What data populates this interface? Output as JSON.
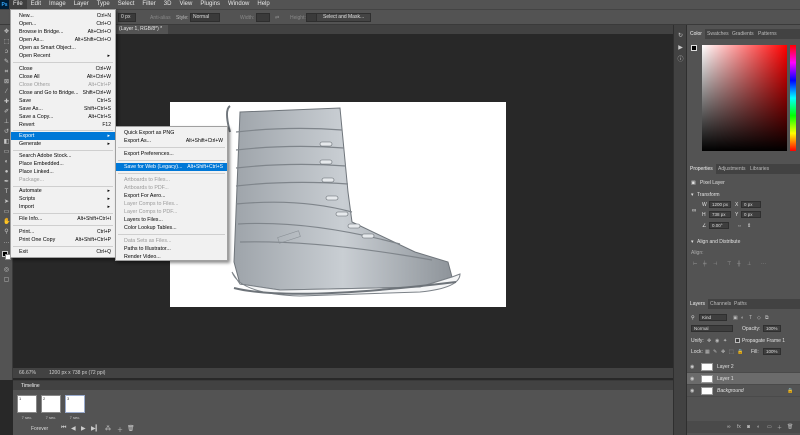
{
  "app": {
    "logo": "Ps"
  },
  "menubar": {
    "items": [
      "File",
      "Edit",
      "Image",
      "Layer",
      "Type",
      "Select",
      "Filter",
      "3D",
      "View",
      "Plugins",
      "Window",
      "Help"
    ]
  },
  "options": {
    "feather_value": "0 px",
    "antialias_label": "Anti-alias",
    "style_label": "Style:",
    "style_value": "Normal",
    "width_label": "Width:",
    "height_label": "Height:",
    "select_mask_label": "Select and Mask..."
  },
  "document": {
    "tab_title": "(Layer 1, RGB/8*) *",
    "zoom": "66.67%",
    "size_info": "1200 px x 738 px (72 ppi)"
  },
  "file_menu": [
    {
      "label": "New...",
      "shortcut": "Ctrl+N"
    },
    {
      "label": "Open...",
      "shortcut": "Ctrl+O"
    },
    {
      "label": "Browse in Bridge...",
      "shortcut": "Alt+Ctrl+O"
    },
    {
      "label": "Open As...",
      "shortcut": "Alt+Shift+Ctrl+O"
    },
    {
      "label": "Open as Smart Object...",
      "shortcut": ""
    },
    {
      "label": "Open Recent",
      "shortcut": "",
      "submenu": true
    },
    {
      "label": "Close",
      "shortcut": "Ctrl+W"
    },
    {
      "label": "Close All",
      "shortcut": "Alt+Ctrl+W"
    },
    {
      "label": "Close Others",
      "shortcut": "Alt+Ctrl+P",
      "disabled": true
    },
    {
      "label": "Close and Go to Bridge...",
      "shortcut": "Shift+Ctrl+W"
    },
    {
      "label": "Save",
      "shortcut": "Ctrl+S"
    },
    {
      "label": "Save As...",
      "shortcut": "Shift+Ctrl+S"
    },
    {
      "label": "Save a Copy...",
      "shortcut": "Alt+Ctrl+S"
    },
    {
      "label": "Revert",
      "shortcut": "F12"
    },
    {
      "label": "Export",
      "shortcut": "",
      "submenu": true,
      "highlighted": true
    },
    {
      "label": "Generate",
      "shortcut": "",
      "submenu": true
    },
    {
      "label": "Search Adobe Stock...",
      "shortcut": ""
    },
    {
      "label": "Place Embedded...",
      "shortcut": ""
    },
    {
      "label": "Place Linked...",
      "shortcut": ""
    },
    {
      "label": "Package...",
      "shortcut": "",
      "disabled": true
    },
    {
      "label": "Automate",
      "shortcut": "",
      "submenu": true
    },
    {
      "label": "Scripts",
      "shortcut": "",
      "submenu": true
    },
    {
      "label": "Import",
      "shortcut": "",
      "submenu": true
    },
    {
      "label": "File Info...",
      "shortcut": "Alt+Shift+Ctrl+I"
    },
    {
      "label": "Print...",
      "shortcut": "Ctrl+P"
    },
    {
      "label": "Print One Copy",
      "shortcut": "Alt+Shift+Ctrl+P"
    },
    {
      "label": "Exit",
      "shortcut": "Ctrl+Q"
    }
  ],
  "export_menu": [
    {
      "label": "Quick Export as PNG",
      "shortcut": ""
    },
    {
      "label": "Export As...",
      "shortcut": "Alt+Shift+Ctrl+W"
    },
    {
      "label": "Export Preferences...",
      "shortcut": ""
    },
    {
      "label": "Save for Web (Legacy)...",
      "shortcut": "Alt+Shift+Ctrl+S",
      "highlighted": true
    },
    {
      "label": "Artboards to Files...",
      "shortcut": "",
      "disabled": true
    },
    {
      "label": "Artboards to PDF...",
      "shortcut": "",
      "disabled": true
    },
    {
      "label": "Export For Aero...",
      "shortcut": ""
    },
    {
      "label": "Layer Comps to Files...",
      "shortcut": "",
      "disabled": true
    },
    {
      "label": "Layer Comps to PDF...",
      "shortcut": "",
      "disabled": true
    },
    {
      "label": "Layers to Files...",
      "shortcut": ""
    },
    {
      "label": "Color Lookup Tables...",
      "shortcut": ""
    },
    {
      "label": "Data Sets as Files...",
      "shortcut": "",
      "disabled": true
    },
    {
      "label": "Paths to Illustrator...",
      "shortcut": ""
    },
    {
      "label": "Render Video...",
      "shortcut": ""
    }
  ],
  "timeline": {
    "title": "Timeline",
    "loop": "Forever",
    "frames": [
      {
        "index": "1",
        "delay": "7 sec."
      },
      {
        "index": "2",
        "delay": "7 sec."
      },
      {
        "index": "3",
        "delay": "7 sec."
      }
    ]
  },
  "color_panel": {
    "tabs": [
      "Color",
      "Swatches",
      "Gradients",
      "Patterns"
    ]
  },
  "properties_panel": {
    "tabs": [
      "Properties",
      "Adjustments",
      "Libraries"
    ],
    "kind": "Pixel Layer",
    "transform_label": "Transform",
    "w": "1200 px",
    "h": "738 px",
    "x": "0 px",
    "y": "0 px",
    "angle": "0.00°",
    "align_label": "Align and Distribute",
    "align_sub": "Align:"
  },
  "layers_panel": {
    "tabs": [
      "Layers",
      "Channels",
      "Paths"
    ],
    "filter": "Kind",
    "blend_mode": "Normal",
    "opacity_label": "Opacity:",
    "opacity": "100%",
    "unify_label": "Unify:",
    "propagate_label": "Propagate Frame 1",
    "lock_label": "Lock:",
    "fill_label": "Fill:",
    "fill": "100%",
    "layers": [
      {
        "name": "Layer 2",
        "selected": false,
        "italic": false
      },
      {
        "name": "Layer 1",
        "selected": true,
        "italic": false
      },
      {
        "name": "Background",
        "selected": false,
        "italic": true
      }
    ]
  }
}
